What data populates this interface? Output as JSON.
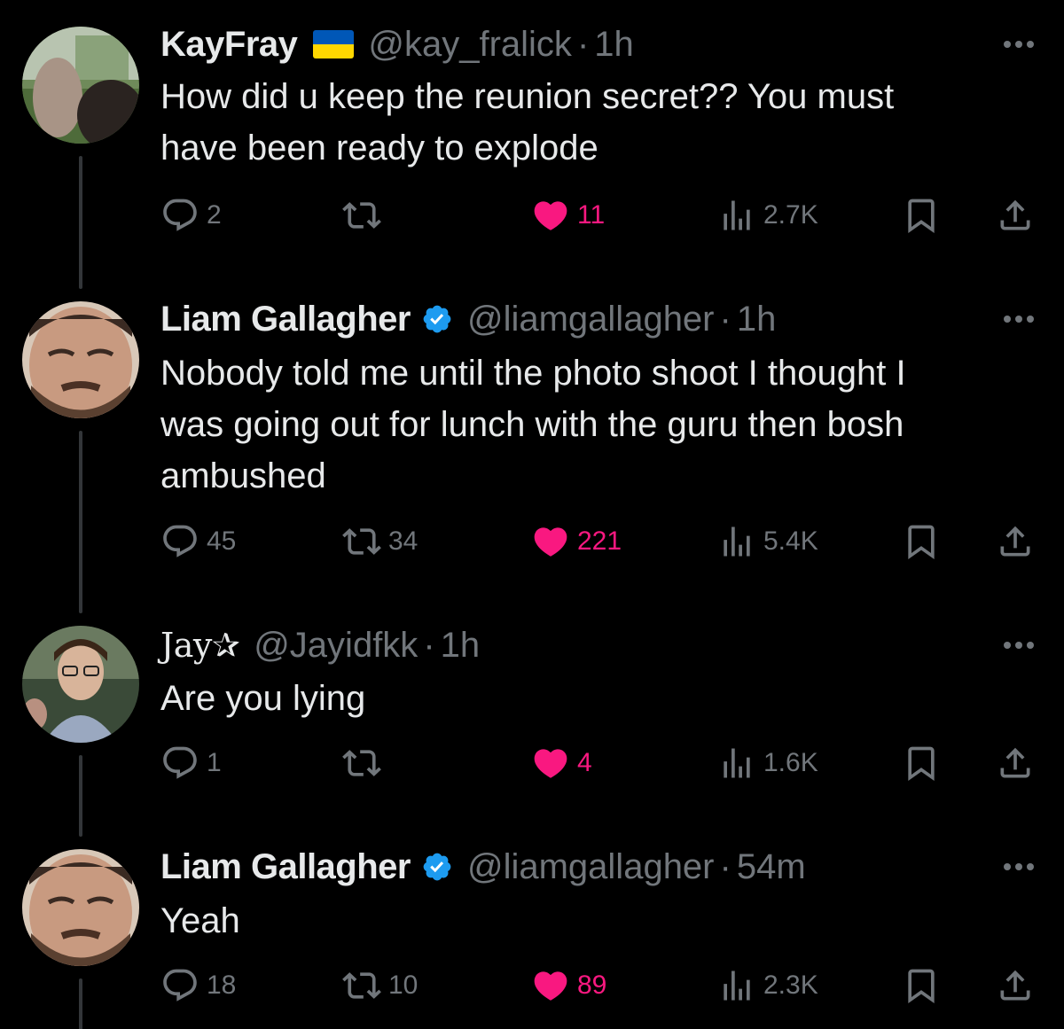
{
  "colors": {
    "background": "#000000",
    "text": "#e7e9ea",
    "muted": "#71767b",
    "like": "#f91880",
    "verified": "#1d9bf0"
  },
  "tweets": [
    {
      "name": "KayFray",
      "flag": "ukraine-flag",
      "handle": "@kay_fralick",
      "sep": "·",
      "time": "1h",
      "lines": [
        "How did u keep the reunion secret??  You must",
        "have been ready to explode"
      ],
      "replies": "2",
      "reposts": "",
      "likes": "11",
      "views": "2.7K"
    },
    {
      "name": "Liam Gallagher",
      "verified": true,
      "handle": "@liamgallagher",
      "sep": "·",
      "time": "1h",
      "lines": [
        "Nobody told me until the photo shoot I thought I",
        "was going out for lunch with the guru then bosh",
        "ambushed"
      ],
      "replies": "45",
      "reposts": "34",
      "likes": "221",
      "views": "5.4K"
    },
    {
      "name": "Jay✰",
      "handle": "@Jayidfkk",
      "sep": "·",
      "time": "1h",
      "lines": [
        "Are you lying"
      ],
      "replies": "1",
      "reposts": "",
      "likes": "4",
      "views": "1.6K"
    },
    {
      "name": "Liam Gallagher",
      "verified": true,
      "handle": "@liamgallagher",
      "sep": "·",
      "time": "54m",
      "lines": [
        "Yeah"
      ],
      "replies": "18",
      "reposts": "10",
      "likes": "89",
      "views": "2.3K"
    }
  ]
}
